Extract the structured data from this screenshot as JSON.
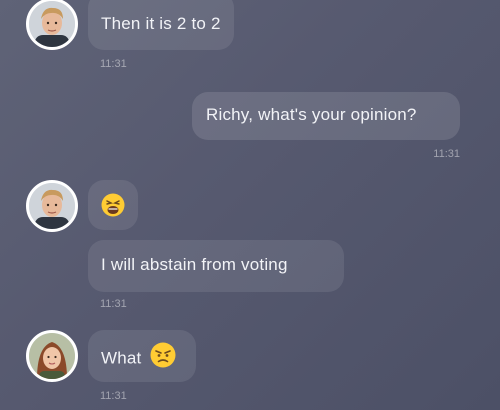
{
  "messages": [
    {
      "id": "m1",
      "text": "Then it is 2 to 2",
      "time": "11:31",
      "side": "in"
    },
    {
      "id": "m2",
      "text": "Richy, what's your opinion?",
      "time": "11:31",
      "side": "out"
    },
    {
      "id": "m3",
      "emoji": "weary-face",
      "side": "in"
    },
    {
      "id": "m4",
      "text": "I will abstain from voting",
      "time": "11:31",
      "side": "in"
    },
    {
      "id": "m5",
      "text": "What",
      "emoji": "angry-face",
      "time": "11:31",
      "side": "in"
    }
  ],
  "colors": {
    "background": "#585b71",
    "bubble": "rgba(255,255,255,0.09)",
    "text": "#f2f3f7",
    "timestamp": "rgba(255,255,255,0.45)",
    "emoji_yellow": "#ffcc33"
  }
}
